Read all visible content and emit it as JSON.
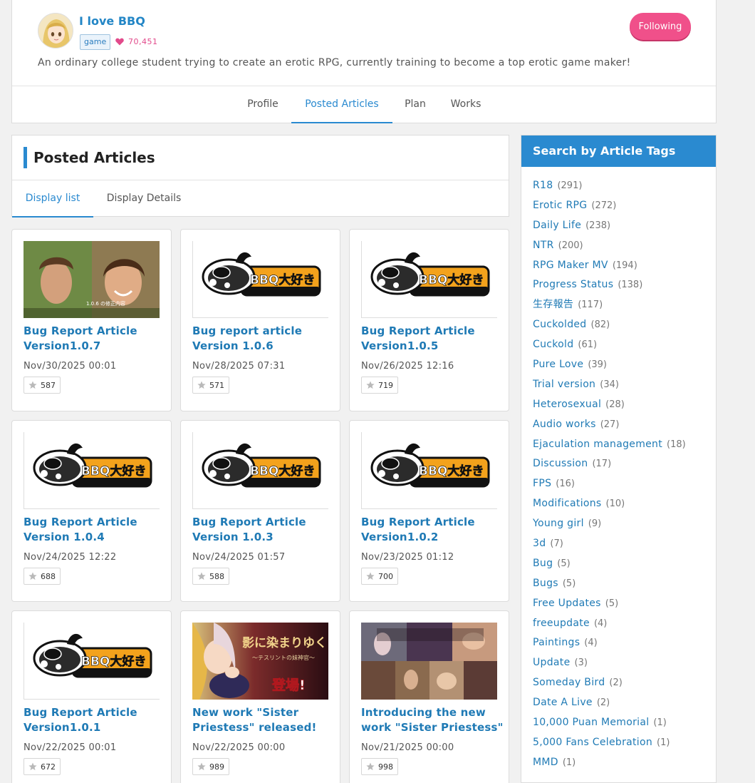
{
  "creator": {
    "name": "I love BBQ",
    "category": "game",
    "fan_count": "70,451",
    "bio": "An ordinary college student trying to create an erotic RPG, currently training to become a top erotic game maker!",
    "follow_label": "Following"
  },
  "profile_tabs": [
    {
      "label": "Profile"
    },
    {
      "label": "Posted Articles"
    },
    {
      "label": "Plan"
    },
    {
      "label": "Works"
    }
  ],
  "articles_panel": {
    "title": "Posted Articles",
    "view_tabs": [
      {
        "label": "Display list"
      },
      {
        "label": "Display Details"
      }
    ]
  },
  "cards": [
    {
      "title": "Bug Report Article Version1.0.7",
      "date": "Nov/30/2025 00:01",
      "likes": "587"
    },
    {
      "title": "Bug report article Version 1.0.6",
      "date": "Nov/28/2025 07:31",
      "likes": "571"
    },
    {
      "title": "Bug Report Article Version1.0.5",
      "date": "Nov/26/2025 12:16",
      "likes": "719"
    },
    {
      "title": "Bug Report Article Version 1.0.4",
      "date": "Nov/24/2025 12:22",
      "likes": "688"
    },
    {
      "title": "Bug Report Article Version 1.0.3",
      "date": "Nov/24/2025 01:57",
      "likes": "588"
    },
    {
      "title": "Bug Report Article Version1.0.2",
      "date": "Nov/23/2025 01:12",
      "likes": "700"
    },
    {
      "title": "Bug Report Article Version1.0.1",
      "date": "Nov/22/2025 00:01",
      "likes": "672"
    },
    {
      "title": "New work \"Sister Priestess\" released!",
      "date": "Nov/22/2025 00:00",
      "likes": "989"
    },
    {
      "title": "Introducing the new work \"Sister Priestess\"",
      "date": "Nov/21/2025 00:00",
      "likes": "998"
    }
  ],
  "thumbnail_text": {
    "logo": "BBQ大好き",
    "photo_overlay": "1.0.6 の修正内容",
    "promo_title": "影に染まりゆく",
    "promo_subtitle": "〜テスリントの妹神官〜",
    "promo_badge": "登場!"
  },
  "tags_sidebar": {
    "title": "Search by Article Tags",
    "tags": [
      {
        "name": "R18",
        "count": "(291)"
      },
      {
        "name": "Erotic RPG",
        "count": "(272)"
      },
      {
        "name": "Daily Life",
        "count": "(238)"
      },
      {
        "name": "NTR",
        "count": "(200)"
      },
      {
        "name": "RPG Maker MV",
        "count": "(194)"
      },
      {
        "name": "Progress Status",
        "count": "(138)"
      },
      {
        "name": "生存報告",
        "count": "(117)"
      },
      {
        "name": "Cuckolded",
        "count": "(82)"
      },
      {
        "name": "Cuckold",
        "count": "(61)"
      },
      {
        "name": "Pure Love",
        "count": "(39)"
      },
      {
        "name": "Trial version",
        "count": "(34)"
      },
      {
        "name": "Heterosexual",
        "count": "(28)"
      },
      {
        "name": "Audio works",
        "count": "(27)"
      },
      {
        "name": "Ejaculation management",
        "count": "(18)"
      },
      {
        "name": "Discussion",
        "count": "(17)"
      },
      {
        "name": "FPS",
        "count": "(16)"
      },
      {
        "name": "Modifications",
        "count": "(10)"
      },
      {
        "name": "Young girl",
        "count": "(9)"
      },
      {
        "name": "3d",
        "count": "(7)"
      },
      {
        "name": "Bug",
        "count": "(5)"
      },
      {
        "name": "Bugs",
        "count": "(5)"
      },
      {
        "name": "Free Updates",
        "count": "(5)"
      },
      {
        "name": "freeupdate",
        "count": "(4)"
      },
      {
        "name": "Paintings",
        "count": "(4)"
      },
      {
        "name": "Update",
        "count": "(3)"
      },
      {
        "name": "Someday Bird",
        "count": "(2)"
      },
      {
        "name": "Date A Live",
        "count": "(2)"
      },
      {
        "name": "10,000 Puan Memorial",
        "count": "(1)"
      },
      {
        "name": "5,000 Fans Celebration",
        "count": "(1)"
      },
      {
        "name": "MMD",
        "count": "(1)"
      }
    ]
  },
  "colors": {
    "accent": "#2a8ad0",
    "link": "#1f7ab5",
    "follow": "#f0508a",
    "heart": "#e24a8b"
  },
  "icons": {
    "heart": "heart-icon",
    "star": "star-icon"
  }
}
